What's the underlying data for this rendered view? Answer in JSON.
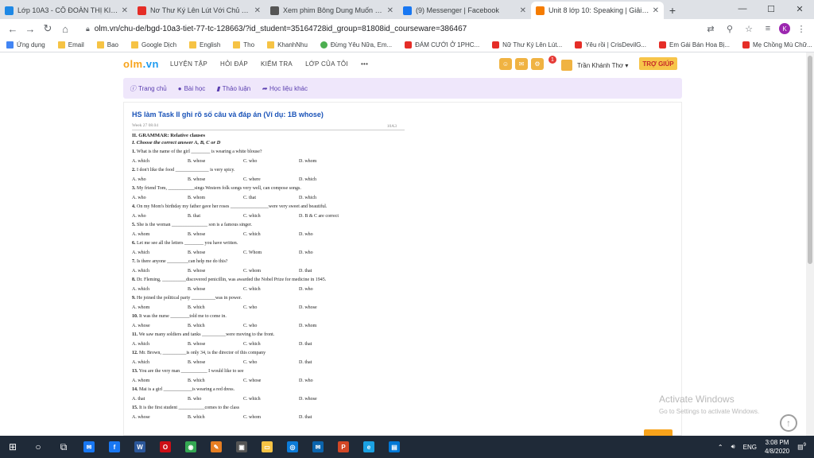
{
  "browser": {
    "tabs": [
      {
        "label": "Lớp 10A3 - CÔ ĐOÀN THỊ KIM U",
        "icon": "cloud-icon",
        "color": "#1e88e5"
      },
      {
        "label": "Nơ Thư Ký Lên Lút Với Chủ Tịch",
        "icon": "youtube-icon",
        "color": "#e52d27"
      },
      {
        "label": "Xem phim Bông Dung Muốn Khó",
        "icon": "gear-icon",
        "color": "#555555"
      },
      {
        "label": "(9) Messenger | Facebook",
        "icon": "facebook-icon",
        "color": "#1877f2"
      },
      {
        "label": "Unit 8 lớp 10: Speaking | Giải bà",
        "icon": "bookmark-icon",
        "color": "#f57c00"
      }
    ],
    "active_tab": 4,
    "url": "olm.vn/chu-de/bgd-10a3-tiet-77-tc-128663/?id_student=35164728id_group=81808id_courseware=386467",
    "profile_initial": "K",
    "bookmarks": [
      {
        "label": "Ứng dụng",
        "type": "apps"
      },
      {
        "label": "Email",
        "type": "folder"
      },
      {
        "label": "Bao",
        "type": "folder"
      },
      {
        "label": "Google Dịch",
        "type": "folder"
      },
      {
        "label": "English",
        "type": "folder"
      },
      {
        "label": "Tho",
        "type": "folder"
      },
      {
        "label": "KhanhNhu",
        "type": "folder"
      },
      {
        "label": "Đừng Yêu Nữa, Em...",
        "type": "globe"
      },
      {
        "label": "ĐÁM CƯỚI Ở 1PHC...",
        "type": "yt"
      },
      {
        "label": "Nữ Thư Ký Lên Lút...",
        "type": "yt"
      },
      {
        "label": "Yêu rồi | CrisDevilG...",
        "type": "yt"
      },
      {
        "label": "Em Gái Bán Hoa Bị...",
        "type": "yt"
      },
      {
        "label": "Mẹ Chồng Mù Chữ...",
        "type": "yt"
      }
    ],
    "bookmarks_more": "»"
  },
  "site": {
    "logo_main": "olm",
    "logo_suffix": ".vn",
    "nav": [
      "LUYỆN TẬP",
      "HỎI ĐÁP",
      "KIỂM TRA",
      "LỚP CỦA TÔI",
      "•••"
    ],
    "notification_count": "1",
    "user_name": "Trần Khánh Thơ ▾",
    "help_label": "TRỢ GIÚP",
    "subnav": [
      "Trang chủ",
      "Bài học",
      "Thảo luận",
      "Học liệu khác"
    ]
  },
  "content": {
    "title": "HS làm Task II ghi rõ số câu và đáp án (Ví dụ: 1B whose)",
    "doc_header_left": "Week 27 08.04",
    "doc_header_right": "10A3",
    "section": "II. GRAMMAR: Relative clauses",
    "instruction": "I. Choose the correct answer A, B, C or D",
    "questions": [
      {
        "num": "1.",
        "text": "What is the name of the girl ________ is wearing a white blouse?",
        "opts": [
          "A. which",
          "B. whose",
          "C. who",
          "D. whom"
        ]
      },
      {
        "num": "2.",
        "text": "I don't like the food ______________ is very spicy.",
        "opts": [
          "A. who",
          "B. whose",
          "C. where",
          "D. which"
        ]
      },
      {
        "num": "3.",
        "text": "My friend Tom, ___________sings Western folk songs very well, can compose songs.",
        "opts": [
          "A. who",
          "B. whom",
          "C. that",
          "D. which"
        ]
      },
      {
        "num": "4.",
        "text": "On my Mom's birthday my father gave her roses ________________were very sweet and beautiful.",
        "opts": [
          "A. who",
          "B. that",
          "C. which",
          "D. B & C are correct"
        ]
      },
      {
        "num": "5.",
        "text": "She is the woman _______________ son is a famous singer.",
        "opts": [
          "A. whom",
          "B. whose",
          "C. which",
          "D. who"
        ]
      },
      {
        "num": "6.",
        "text": "Let me see all the letters ________ you have written.",
        "opts": [
          "A. which",
          "B. whose",
          "C. Whom",
          "D. who"
        ]
      },
      {
        "num": "7.",
        "text": "Is there anyone _________can help me do this?",
        "opts": [
          "A. which",
          "B. whose",
          "C. whom",
          "D. that"
        ]
      },
      {
        "num": "8.",
        "text": "Dr. Fleming, __________discovered penicillin, was awarded the Nobel Prize for medicine in 1945.",
        "opts": [
          "A. which",
          "B. whose",
          "C. which",
          "D. who"
        ]
      },
      {
        "num": "9.",
        "text": "He joined the political party __________was in power.",
        "opts": [
          "A. whom",
          "B. which",
          "C. who",
          "D. whose"
        ]
      },
      {
        "num": "10.",
        "text": "It was the nurse ________told me to come in.",
        "opts": [
          "A. whose",
          "B. which",
          "C. who",
          "D. whom"
        ]
      },
      {
        "num": "11.",
        "text": "We saw many soldiers and tanks __________were moving to the front.",
        "opts": [
          "A. which",
          "B. whose",
          "C. which",
          "D. that"
        ]
      },
      {
        "num": "12.",
        "text": "Mr. Brown, __________is only 34, is the director of this company",
        "opts": [
          "A. which",
          "B. whose",
          "C. who",
          "D. that"
        ]
      },
      {
        "num": "13.",
        "text": "You are the very man ___________ I would like to see",
        "opts": [
          "A. whom",
          "B. which",
          "C. whose",
          "D. who"
        ]
      },
      {
        "num": "14.",
        "text": "Mai is a girl ____________is wearing a red dress.",
        "opts": [
          "A. that",
          "B. who",
          "C. which",
          "D. whose"
        ]
      },
      {
        "num": "15.",
        "text": "It is the first student ___________comes to the class",
        "opts": [
          "A. whose",
          "B. which",
          "C. whom",
          "D. that"
        ]
      }
    ]
  },
  "overlay": {
    "activate_title": "Activate Windows",
    "activate_sub": "Go to Settings to activate Windows."
  },
  "taskbar": {
    "apps": [
      {
        "name": "start-icon",
        "glyph": "⊞",
        "color": ""
      },
      {
        "name": "search-circle-icon",
        "glyph": "○",
        "color": ""
      },
      {
        "name": "task-view-icon",
        "glyph": "⧉",
        "color": ""
      },
      {
        "name": "messenger-icon",
        "glyph": "✉",
        "color": "#1877f2"
      },
      {
        "name": "facebook-icon",
        "glyph": "f",
        "color": "#1877f2"
      },
      {
        "name": "word-icon",
        "glyph": "W",
        "color": "#2b579a"
      },
      {
        "name": "opera-icon",
        "glyph": "O",
        "color": "#cc0f16"
      },
      {
        "name": "chrome-icon",
        "glyph": "◉",
        "color": "#34a853"
      },
      {
        "name": "paint-icon",
        "glyph": "✎",
        "color": "#e67e22"
      },
      {
        "name": "camera-icon",
        "glyph": "▣",
        "color": "#555555"
      },
      {
        "name": "explorer-icon",
        "glyph": "▭",
        "color": "#f6c344"
      },
      {
        "name": "edge-icon",
        "glyph": "◎",
        "color": "#0c7bd8"
      },
      {
        "name": "mail-icon",
        "glyph": "✉",
        "color": "#0a64ad"
      },
      {
        "name": "powerpoint-icon",
        "glyph": "P",
        "color": "#d24726"
      },
      {
        "name": "ie-icon",
        "glyph": "e",
        "color": "#1ba1e2"
      },
      {
        "name": "app-icon",
        "glyph": "▤",
        "color": "#0078d7"
      }
    ],
    "lang": "ENG",
    "time": "3:08 PM",
    "date": "4/8/2020",
    "notif_count": "9"
  }
}
